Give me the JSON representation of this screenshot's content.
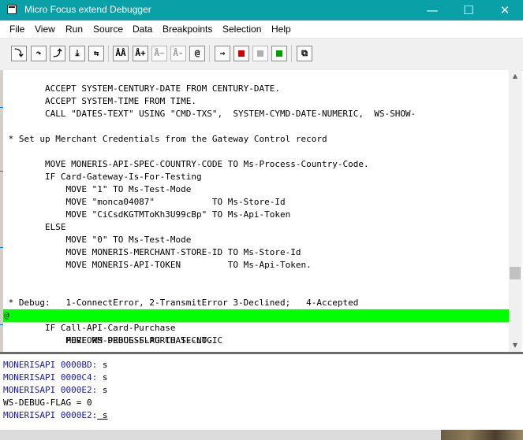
{
  "window": {
    "title": "Micro Focus extend Debugger",
    "controls": {
      "minimize": "—",
      "maximize": "☐",
      "close": "✕"
    }
  },
  "menu": [
    "File",
    "View",
    "Run",
    "Source",
    "Data",
    "Breakpoints",
    "Selection",
    "Help"
  ],
  "toolbar": {
    "buttons": [
      {
        "name": "step-into-icon",
        "glyph": "⤵",
        "enabled": true
      },
      {
        "name": "step-over-icon",
        "glyph": "↷",
        "enabled": true
      },
      {
        "name": "step-out-icon",
        "glyph": "⤴",
        "enabled": true
      },
      {
        "name": "run-to-cursor-icon",
        "glyph": "⤓",
        "enabled": true
      },
      {
        "name": "step-back-icon",
        "glyph": "⇆",
        "enabled": true
      },
      {
        "name": "watch-icon",
        "glyph": "ÅÅ",
        "enabled": true
      },
      {
        "name": "watch-add-icon",
        "glyph": "Å+",
        "enabled": true
      },
      {
        "name": "watch-edit-icon",
        "glyph": "Å~",
        "enabled": false
      },
      {
        "name": "watch-remove-icon",
        "glyph": "Å-",
        "enabled": false
      },
      {
        "name": "at-icon",
        "glyph": "@",
        "enabled": true
      },
      {
        "name": "go-icon",
        "glyph": "⇒",
        "enabled": true
      },
      {
        "name": "breakpoint-set-icon",
        "glyph": "",
        "enabled": true
      },
      {
        "name": "breakpoint-disabled-icon",
        "glyph": "",
        "enabled": false
      },
      {
        "name": "breakpoint-enable-icon",
        "glyph": "",
        "enabled": true
      },
      {
        "name": "window-icon",
        "glyph": "⧉",
        "enabled": true
      }
    ]
  },
  "source": {
    "lines": [
      {
        "text": "        ACCEPT SYSTEM-CENTURY-DATE FROM CENTURY-DATE.",
        "bp": ""
      },
      {
        "text": "        ACCEPT SYSTEM-TIME FROM TIME.",
        "bp": ""
      },
      {
        "text": "        CALL \"DATES-TEXT\" USING \"CMD-TXS\",  SYSTEM-CYMD-DATE-NUMERIC,  WS-SHOW-",
        "bp": ""
      },
      {
        "text": "",
        "bp": ""
      },
      {
        "text": " * Set up Merchant Credentials from the Gateway Control record",
        "bp": ""
      },
      {
        "text": "",
        "bp": ""
      },
      {
        "text": "        MOVE MONERIS-API-SPEC-COUNTRY-CODE TO Ms-Process-Country-Code.",
        "bp": ""
      },
      {
        "text": "        IF Card-Gateway-Is-For-Testing",
        "bp": ""
      },
      {
        "text": "            MOVE \"1\" TO Ms-Test-Mode",
        "bp": ""
      },
      {
        "text": "            MOVE \"monca04087\"           TO Ms-Store-Id",
        "bp": ""
      },
      {
        "text": "            MOVE \"CiCsdKGTMToKh3U99cBp\" TO Ms-Api-Token",
        "bp": ""
      },
      {
        "text": "        ELSE",
        "bp": ""
      },
      {
        "text": "            MOVE \"0\" TO Ms-Test-Mode",
        "bp": ""
      },
      {
        "text": "            MOVE MONERIS-MERCHANT-STORE-ID TO Ms-Store-Id",
        "bp": ""
      },
      {
        "text": "            MOVE MONERIS-API-TOKEN         TO Ms-Api-Token.",
        "bp": ""
      },
      {
        "text": "",
        "bp": ""
      },
      {
        "text": "",
        "bp": ""
      },
      {
        "text": " * Debug:   1-ConnectError, 2-TransmitError 3-Declined;   4-Accepted",
        "bp": ""
      },
      {
        "text": "        MOVE WS-DEBUG-FLAG TO T-CNT.",
        "bp": "@",
        "current": true
      },
      {
        "text": "        IF Call-API-Card-Purchase",
        "bp": ""
      },
      {
        "text": "            PERFORM PROCESS-PURCHASE-LOGIC",
        "bp": ""
      }
    ]
  },
  "console": {
    "lines": [
      {
        "prefix": "MONERISAPI 0000BD:",
        "rest": " s"
      },
      {
        "prefix": "MONERISAPI 0000C4:",
        "rest": " s"
      },
      {
        "prefix": "MONERISAPI 0000E2:",
        "rest": " s"
      },
      {
        "prefix": "",
        "rest": "WS-DEBUG-FLAG = 0"
      },
      {
        "prefix": "MONERISAPI 0000E2:",
        "rest": " s"
      }
    ]
  },
  "colors": {
    "titlebar": "#0aa0a8",
    "current_line": "#00ff00",
    "console_prefix": "#1a1aa6"
  }
}
